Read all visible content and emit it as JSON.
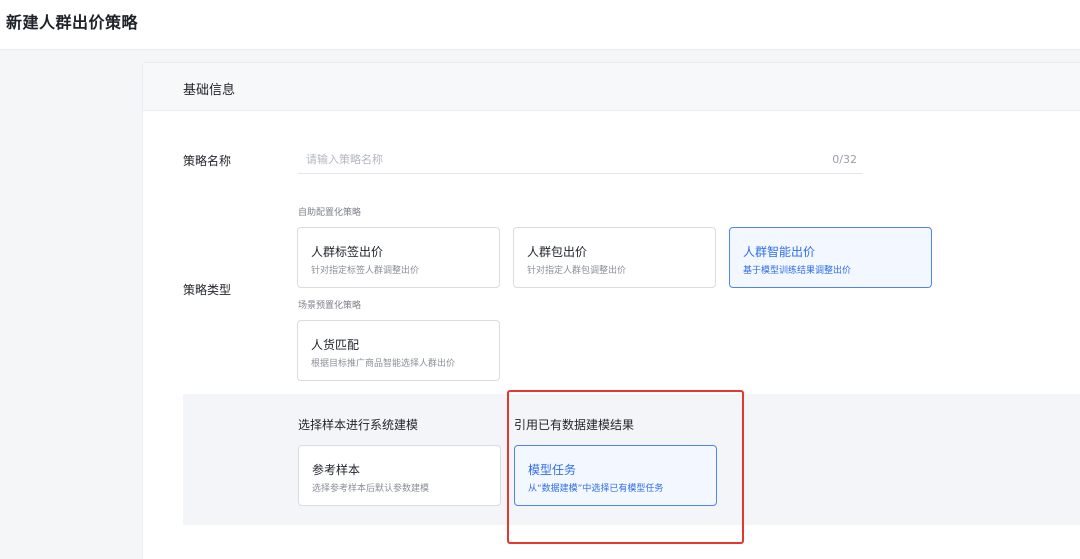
{
  "page": {
    "title": "新建人群出价策略"
  },
  "section": {
    "title": "基础信息"
  },
  "strategy_name": {
    "label": "策略名称",
    "placeholder": "请输入策略名称",
    "value": "",
    "count": "0/32"
  },
  "strategy_type": {
    "label": "策略类型",
    "groups": [
      {
        "label": "自助配置化策略",
        "options": [
          {
            "title": "人群标签出价",
            "desc": "针对指定标签人群调整出价",
            "selected": false
          },
          {
            "title": "人群包出价",
            "desc": "针对指定人群包调整出价",
            "selected": false
          },
          {
            "title": "人群智能出价",
            "desc": "基于模型训练结果调整出价",
            "selected": true
          }
        ]
      },
      {
        "label": "场景预置化策略",
        "options": [
          {
            "title": "人货匹配",
            "desc": "根据目标推广商品智能选择人群出价",
            "selected": false
          }
        ]
      }
    ]
  },
  "modeling": {
    "sample": {
      "heading": "选择样本进行系统建模",
      "card_title": "参考样本",
      "card_desc": "选择参考样本后默认参数建模",
      "selected": false
    },
    "existing": {
      "heading": "引用已有数据建模结果",
      "card_title": "模型任务",
      "card_desc": "从“数据建模”中选择已有模型任务",
      "selected": true
    }
  },
  "colors": {
    "accent": "#2f6ee8",
    "selected_bg": "#f3f7ff",
    "highlight_box": "#e6372f"
  }
}
